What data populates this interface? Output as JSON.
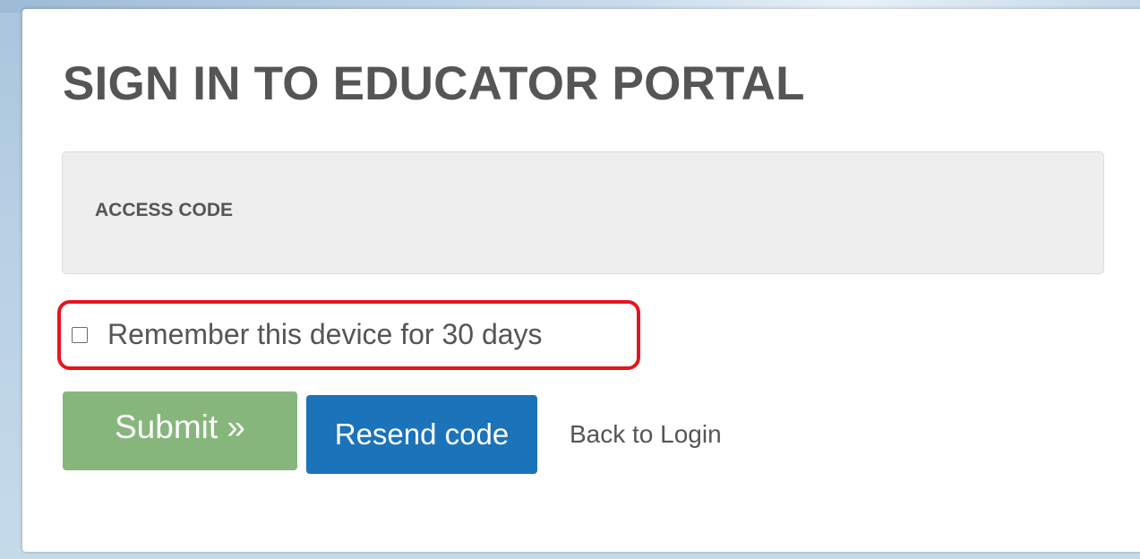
{
  "page": {
    "title": "SIGN IN TO EDUCATOR PORTAL"
  },
  "form": {
    "access_code_label": "ACCESS CODE",
    "remember_label": "Remember this device for 30 days",
    "remember_checked": false
  },
  "actions": {
    "submit_label": "Submit »",
    "resend_label": "Resend code",
    "back_label": "Back to Login"
  },
  "colors": {
    "submit": "#86b67c",
    "resend": "#1b73ba",
    "highlight": "#e8141b"
  }
}
